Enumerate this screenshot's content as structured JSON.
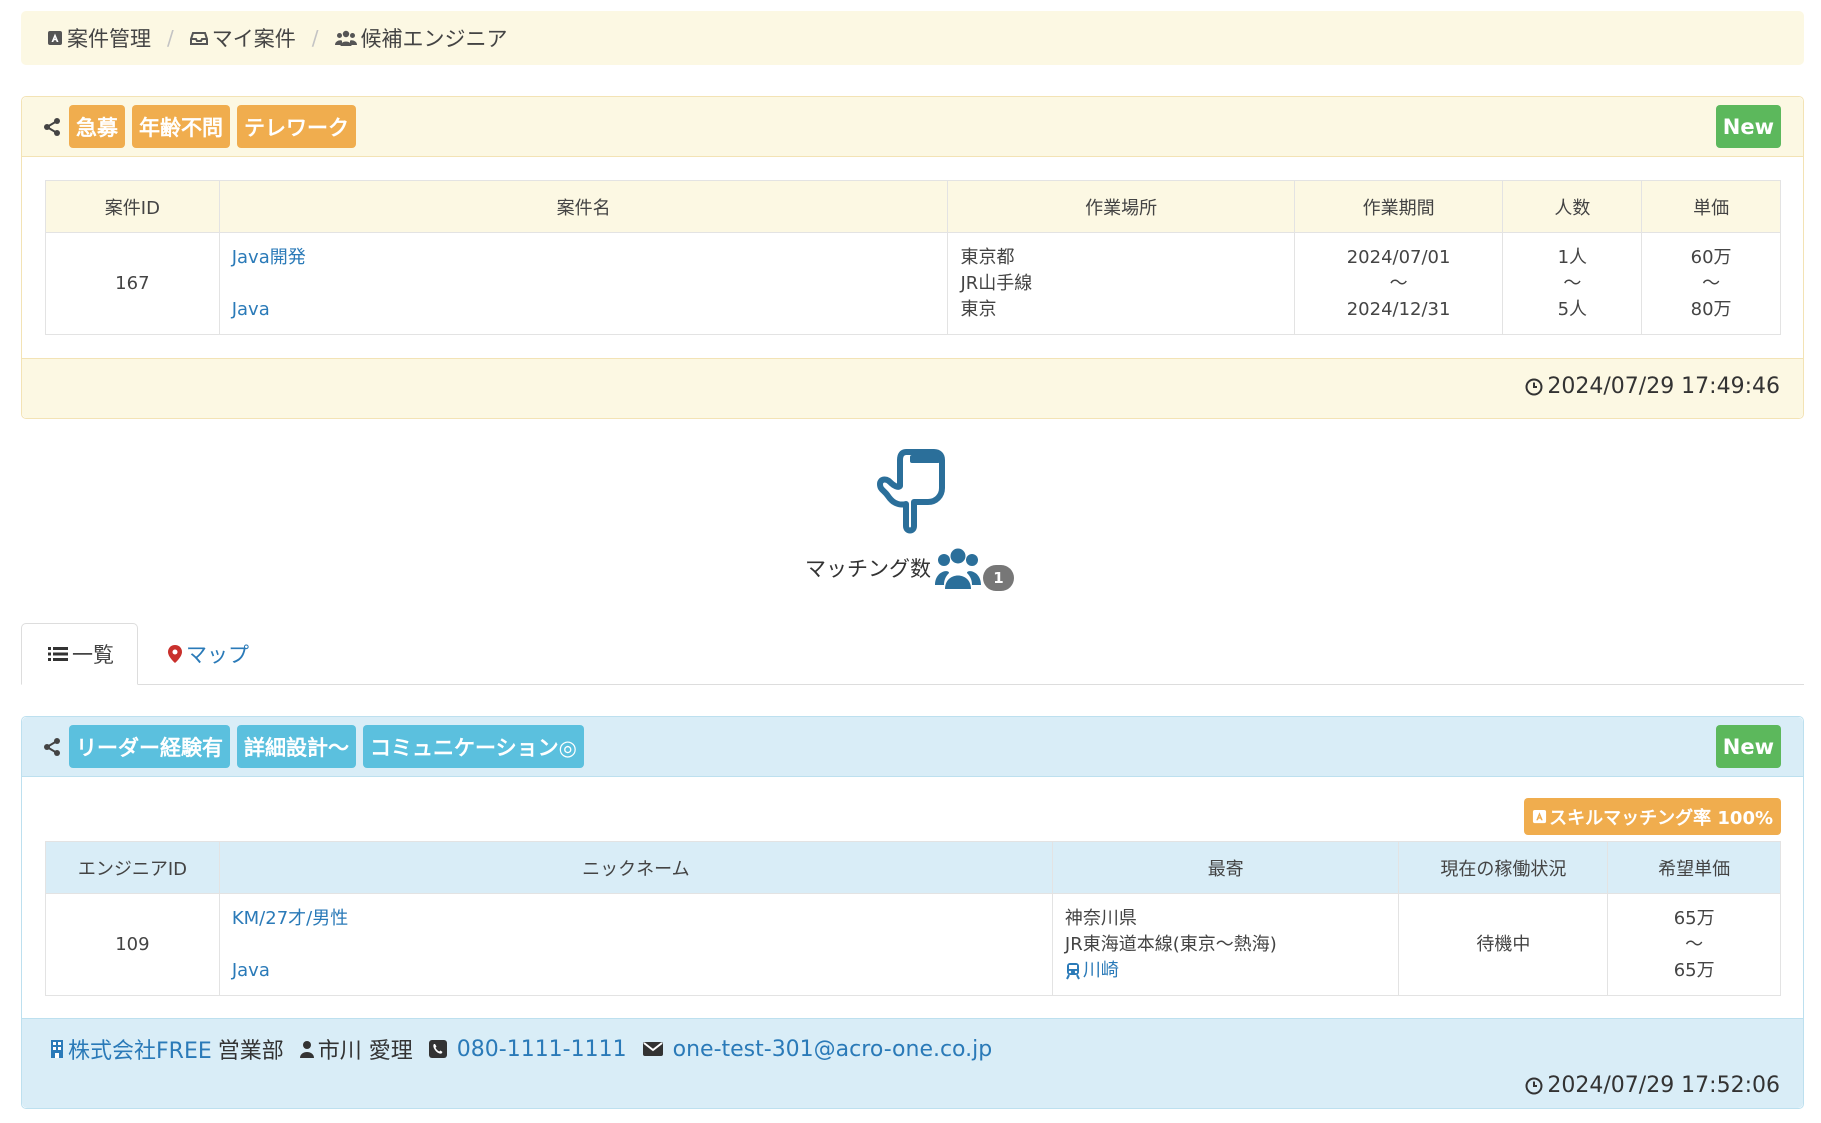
{
  "breadcrumb": {
    "items": [
      {
        "label": "案件管理",
        "icon": "project-icon"
      },
      {
        "label": "マイ案件",
        "icon": "inbox-icon"
      },
      {
        "label": "候補エンジニア",
        "icon": "users-icon"
      }
    ],
    "separator": "/"
  },
  "project_card": {
    "tags": [
      "急募",
      "年齢不問",
      "テレワーク"
    ],
    "new_label": "New",
    "columns": [
      "案件ID",
      "案件名",
      "作業場所",
      "作業期間",
      "人数",
      "単価"
    ],
    "row": {
      "id": "167",
      "name_link": "Java開発",
      "skill_link": "Java",
      "location": [
        "東京都",
        "JR山手線",
        "東京"
      ],
      "period": [
        "2024/07/01",
        "～",
        "2024/12/31"
      ],
      "people": [
        "1人",
        "～",
        "5人"
      ],
      "price": [
        "60万",
        "～",
        "80万"
      ]
    },
    "timestamp": "2024/07/29 17:49:46"
  },
  "matching": {
    "label": "マッチング数",
    "count": "1"
  },
  "tabs": {
    "list": "一覧",
    "map": "マップ"
  },
  "engineer_card": {
    "tags": [
      "リーダー経験有",
      "詳細設計～",
      "コミュニケーション◎"
    ],
    "new_label": "New",
    "skill_match": "スキルマッチング率 100%",
    "columns": [
      "エンジニアID",
      "ニックネーム",
      "最寄",
      "現在の稼働状況",
      "希望単価"
    ],
    "row": {
      "id": "109",
      "nickname_link": "KM/27才/男性",
      "skill_link": "Java",
      "nearest": [
        "神奈川県",
        "JR東海道本線(東京～熱海)"
      ],
      "station_link": "川崎",
      "status": "待機中",
      "price": [
        "65万",
        "～",
        "65万"
      ]
    },
    "contact": {
      "company": "株式会社FREE",
      "department": "営業部",
      "person": "市川 愛理",
      "phone": "080-1111-1111",
      "email": "one-test-301@acro-one.co.jp"
    },
    "timestamp": "2024/07/29 17:52:06"
  },
  "colors": {
    "orange": "#f0ad4e",
    "blue_tag": "#5bc0de",
    "green": "#5cb85c",
    "link": "#2a7ab8",
    "icon_blue": "#2b6f9a"
  }
}
